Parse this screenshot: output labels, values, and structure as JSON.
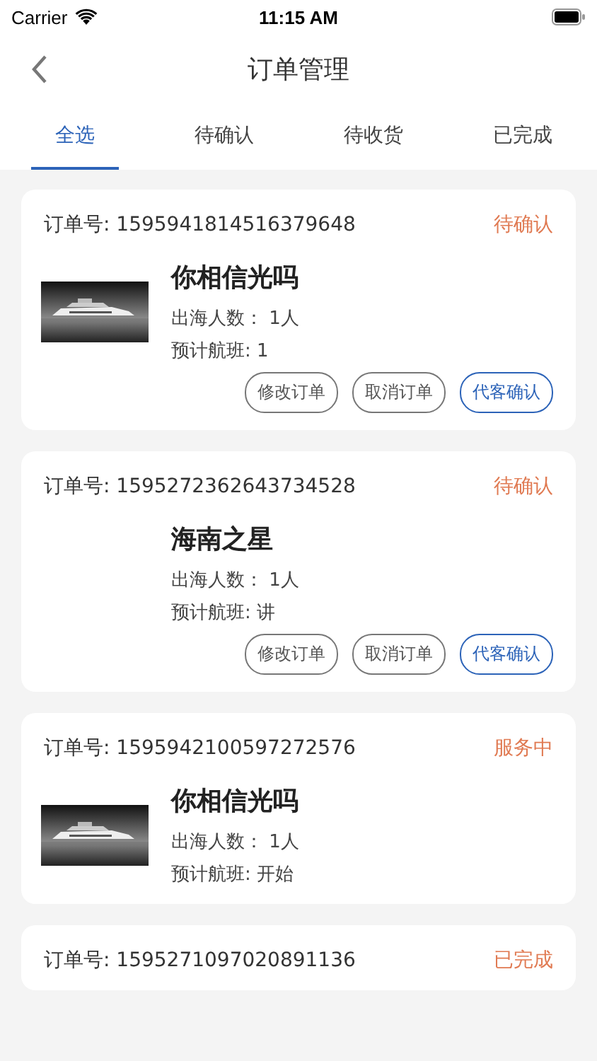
{
  "status_bar": {
    "carrier": "Carrier",
    "time": "11:15 AM"
  },
  "nav": {
    "title": "订单管理"
  },
  "tabs": [
    {
      "label": "全选",
      "selected": true
    },
    {
      "label": "待确认",
      "selected": false
    },
    {
      "label": "待收货",
      "selected": false
    },
    {
      "label": "已完成",
      "selected": false
    }
  ],
  "orders": [
    {
      "order_no": "订单号: 1595941814516379648",
      "status": "待确认",
      "has_picture": true,
      "name": "你相信光吗",
      "people": "出海人数：  1人",
      "flight": "预计航班: 1",
      "actions": [
        {
          "label": "修改订单",
          "primary": false
        },
        {
          "label": "取消订单",
          "primary": false
        },
        {
          "label": "代客确认",
          "primary": true
        }
      ]
    },
    {
      "order_no": "订单号: 1595272362643734528",
      "status": "待确认",
      "has_picture": false,
      "name": "海南之星",
      "people": "出海人数：  1人",
      "flight": "预计航班: 讲",
      "actions": [
        {
          "label": "修改订单",
          "primary": false
        },
        {
          "label": "取消订单",
          "primary": false
        },
        {
          "label": "代客确认",
          "primary": true
        }
      ]
    },
    {
      "order_no": "订单号: 1595942100597272576",
      "status": "服务中",
      "has_picture": true,
      "name": "你相信光吗",
      "people": "出海人数：  1人",
      "flight": "预计航班: 开始"
    },
    {
      "order_no": "订单号: 1595271097020891136",
      "status": "已完成"
    }
  ]
}
